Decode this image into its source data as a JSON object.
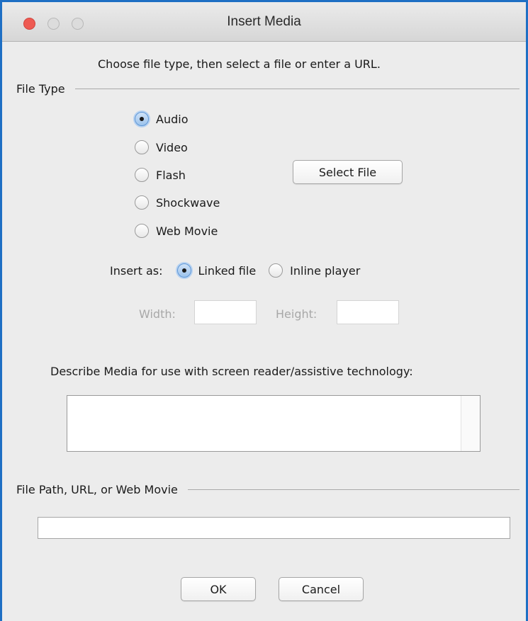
{
  "window": {
    "title": "Insert Media"
  },
  "instruction": "Choose file type, then select a file or enter a URL.",
  "file_type": {
    "group_label": "File Type",
    "options": [
      {
        "label": "Audio",
        "checked": true
      },
      {
        "label": "Video",
        "checked": false
      },
      {
        "label": "Flash",
        "checked": false
      },
      {
        "label": "Shockwave",
        "checked": false
      },
      {
        "label": "Web Movie",
        "checked": false
      }
    ],
    "select_file_label": "Select File"
  },
  "insert_as": {
    "label": "Insert as:",
    "options": [
      {
        "label": "Linked file",
        "checked": true
      },
      {
        "label": "Inline player",
        "checked": false
      }
    ]
  },
  "dimensions": {
    "width_label": "Width:",
    "width_value": "",
    "height_label": "Height:",
    "height_value": ""
  },
  "description": {
    "label": "Describe Media for use with screen reader/assistive technology:",
    "value": ""
  },
  "file_path": {
    "group_label": "File Path, URL, or Web Movie",
    "value": ""
  },
  "buttons": {
    "ok_label": "OK",
    "cancel_label": "Cancel"
  },
  "colors": {
    "window_border": "#1e6fc4",
    "close_button": "#ee5a52",
    "radio_selected": "#9cc3ec"
  }
}
